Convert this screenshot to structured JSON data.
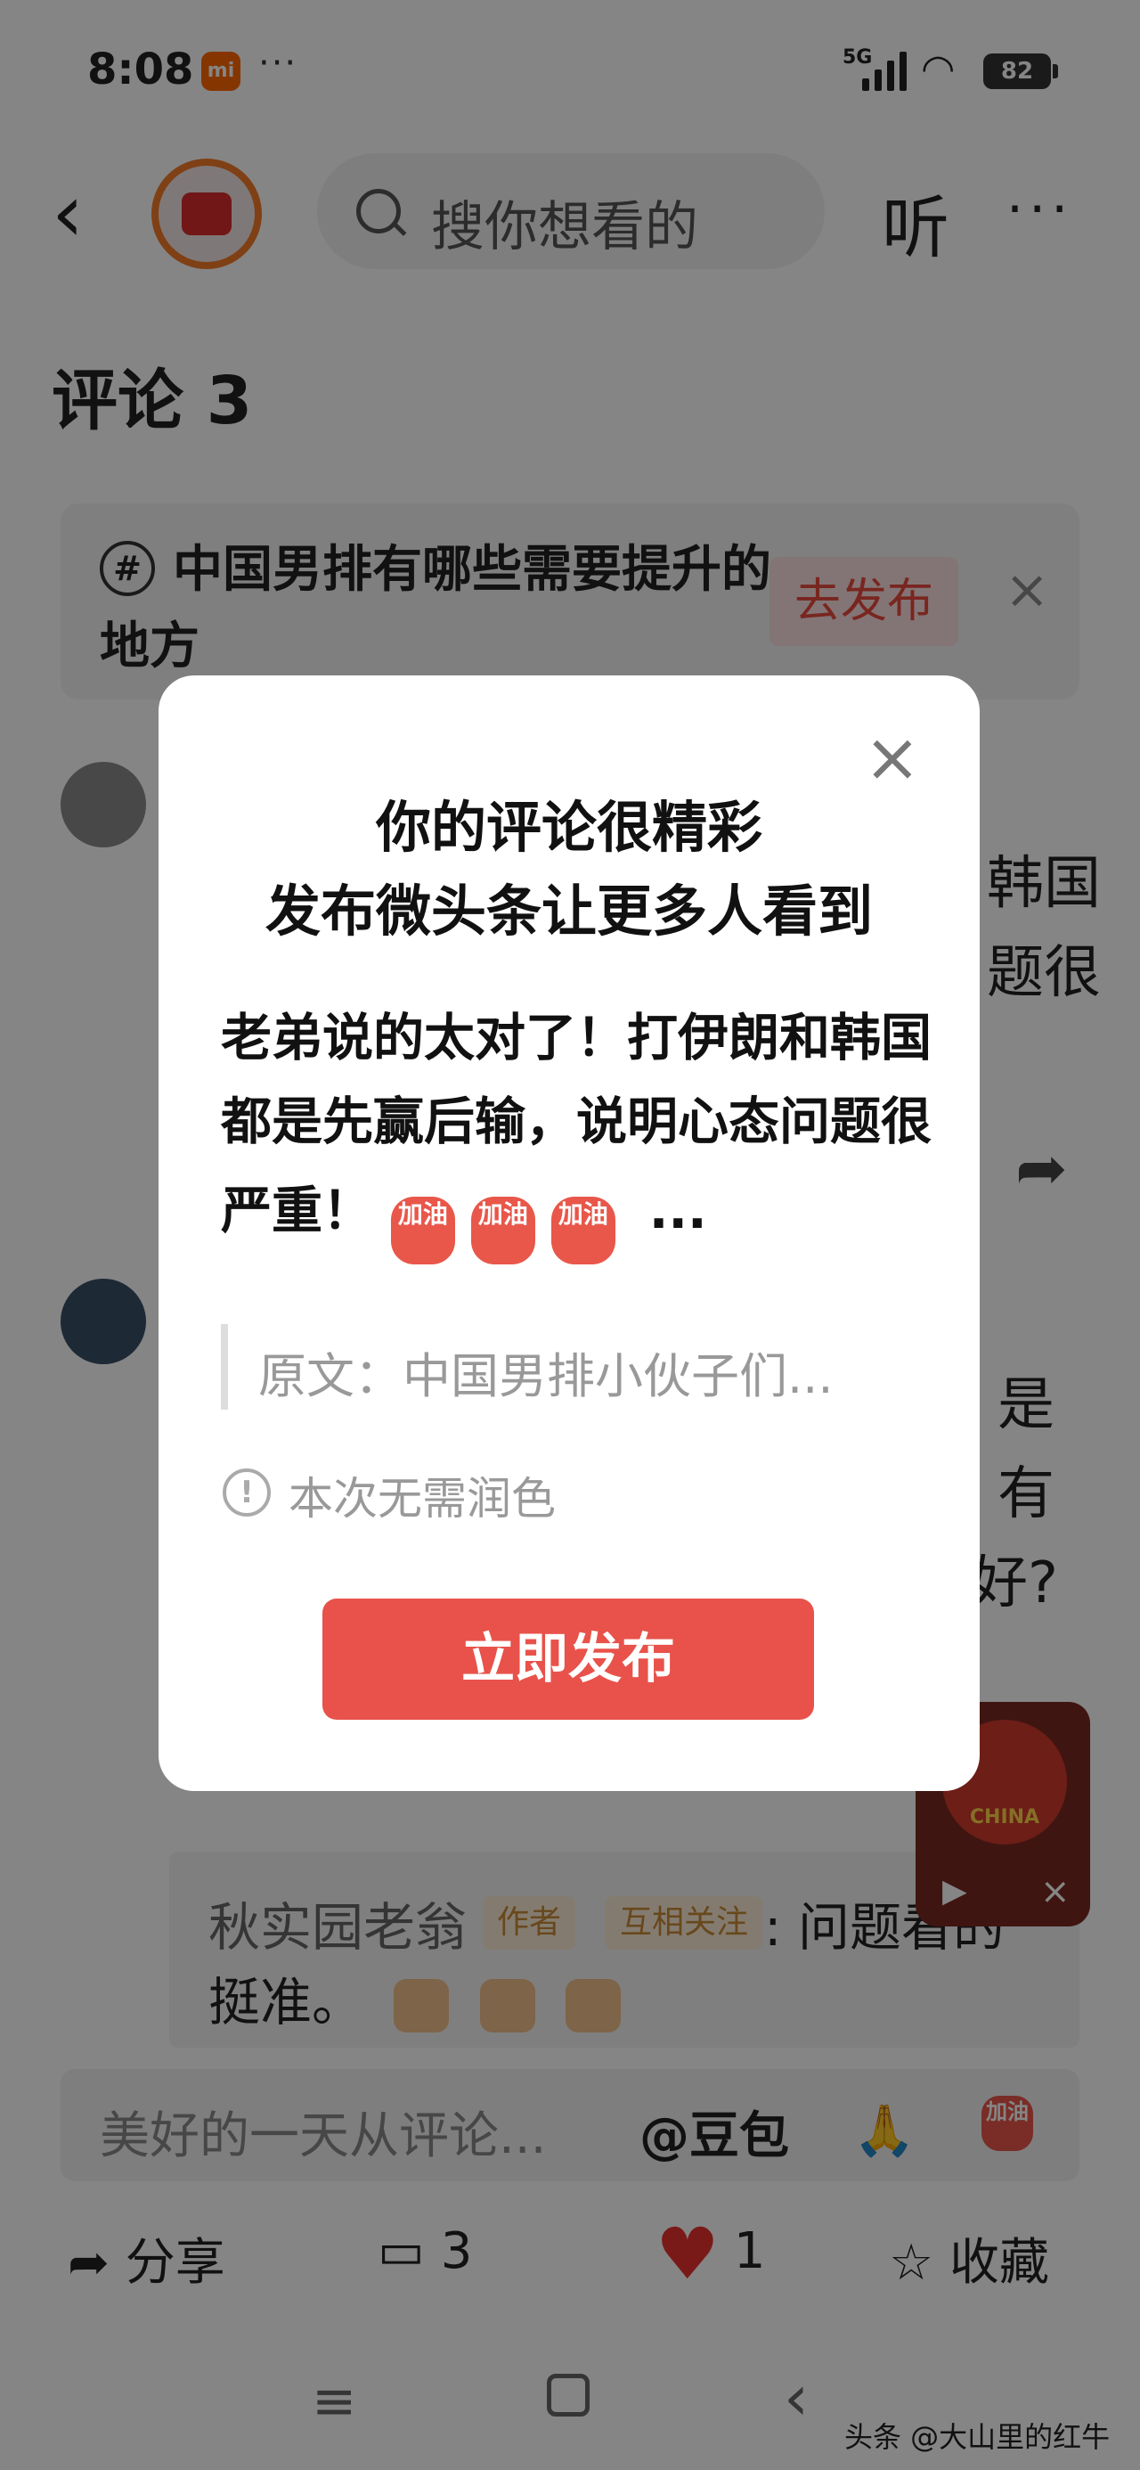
{
  "status_bar": {
    "time": "8:08",
    "mi_badge": "mi",
    "dots": "···",
    "network": "5G",
    "battery": "82"
  },
  "nav": {
    "back": "‹",
    "search_placeholder": "搜你想看的",
    "listen": "听",
    "more": "···"
  },
  "comments_header": "评论 3",
  "topic": {
    "text": "中国男排有哪些需要提升的地方",
    "publish_label": "去发布",
    "close": "×"
  },
  "background_comments": [
    {
      "text_right_1": "韩国",
      "text_right_2": "题很"
    },
    {
      "text_right_1": "是",
      "text_right_2": "有",
      "text_right_3": "好?"
    }
  ],
  "reply": {
    "author": "秋实园老翁",
    "tag_author": "作者",
    "tag_follow": "互相关注",
    "text_tail": ": 问题看的",
    "text_line2": "挺准。"
  },
  "floating_video": {
    "label": "CHINA"
  },
  "input": {
    "placeholder": "美好的一天从评论...",
    "at_doubao": "@豆包",
    "emoji_text": "加油"
  },
  "bottom_actions": {
    "share": "分享",
    "comments": "3",
    "likes": "1",
    "favorite": "收藏"
  },
  "watermark": "头条 @大山里的红牛",
  "modal": {
    "title_line1": "你的评论很精彩",
    "title_line2": "发布微头条让更多人看到",
    "body": "老弟说的太对了！打伊朗和韩国都是先赢后输，说明心态问题很严重！",
    "body_ellipsis": "...",
    "lantern_text": "加油",
    "quote": "原文：中国男排小伙子们...",
    "info": "本次无需润色",
    "publish_button": "立即发布",
    "close": "×"
  },
  "colors": {
    "accent": "#e8524a",
    "tag_bg": "#fdebd6",
    "heart": "#e8332e"
  }
}
